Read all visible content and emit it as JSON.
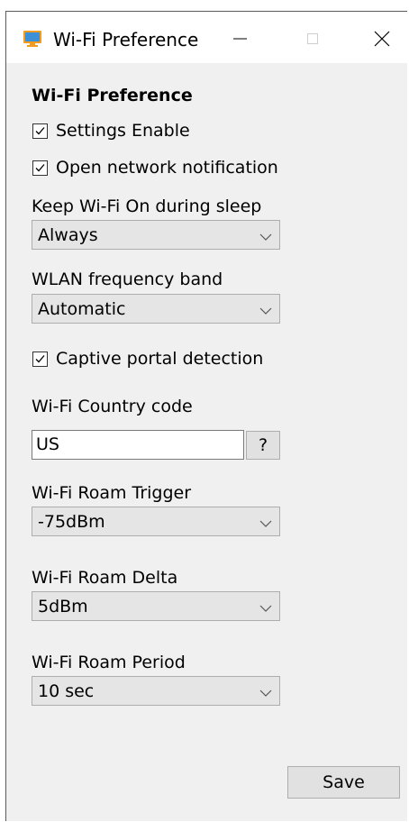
{
  "window": {
    "title": "Wi-Fi Preference",
    "controls": {
      "minimize": "minimize",
      "maximize": "maximize",
      "close": "close"
    }
  },
  "form": {
    "heading": "Wi-Fi Preference",
    "settings_enable": {
      "label": "Settings Enable",
      "checked": true
    },
    "open_network_notification": {
      "label": "Open network notification",
      "checked": true
    },
    "keep_wifi_on": {
      "label": "Keep Wi-Fi On during sleep",
      "value": "Always"
    },
    "wlan_band": {
      "label": "WLAN frequency band",
      "value": "Automatic"
    },
    "captive_portal": {
      "label": "Captive portal detection",
      "checked": true
    },
    "country_code": {
      "label": "Wi-Fi Country code",
      "value": "US",
      "help_label": "?"
    },
    "roam_trigger": {
      "label": "Wi-Fi Roam Trigger",
      "value": "-75dBm"
    },
    "roam_delta": {
      "label": "Wi-Fi Roam Delta",
      "value": "5dBm"
    },
    "roam_period": {
      "label": "Wi-Fi Roam Period",
      "value": "10 sec"
    },
    "save_label": "Save"
  },
  "icons": {
    "app": "wifi-preference-app-icon",
    "check": "checkmark-icon",
    "dropdown": "chevron-down-icon"
  }
}
